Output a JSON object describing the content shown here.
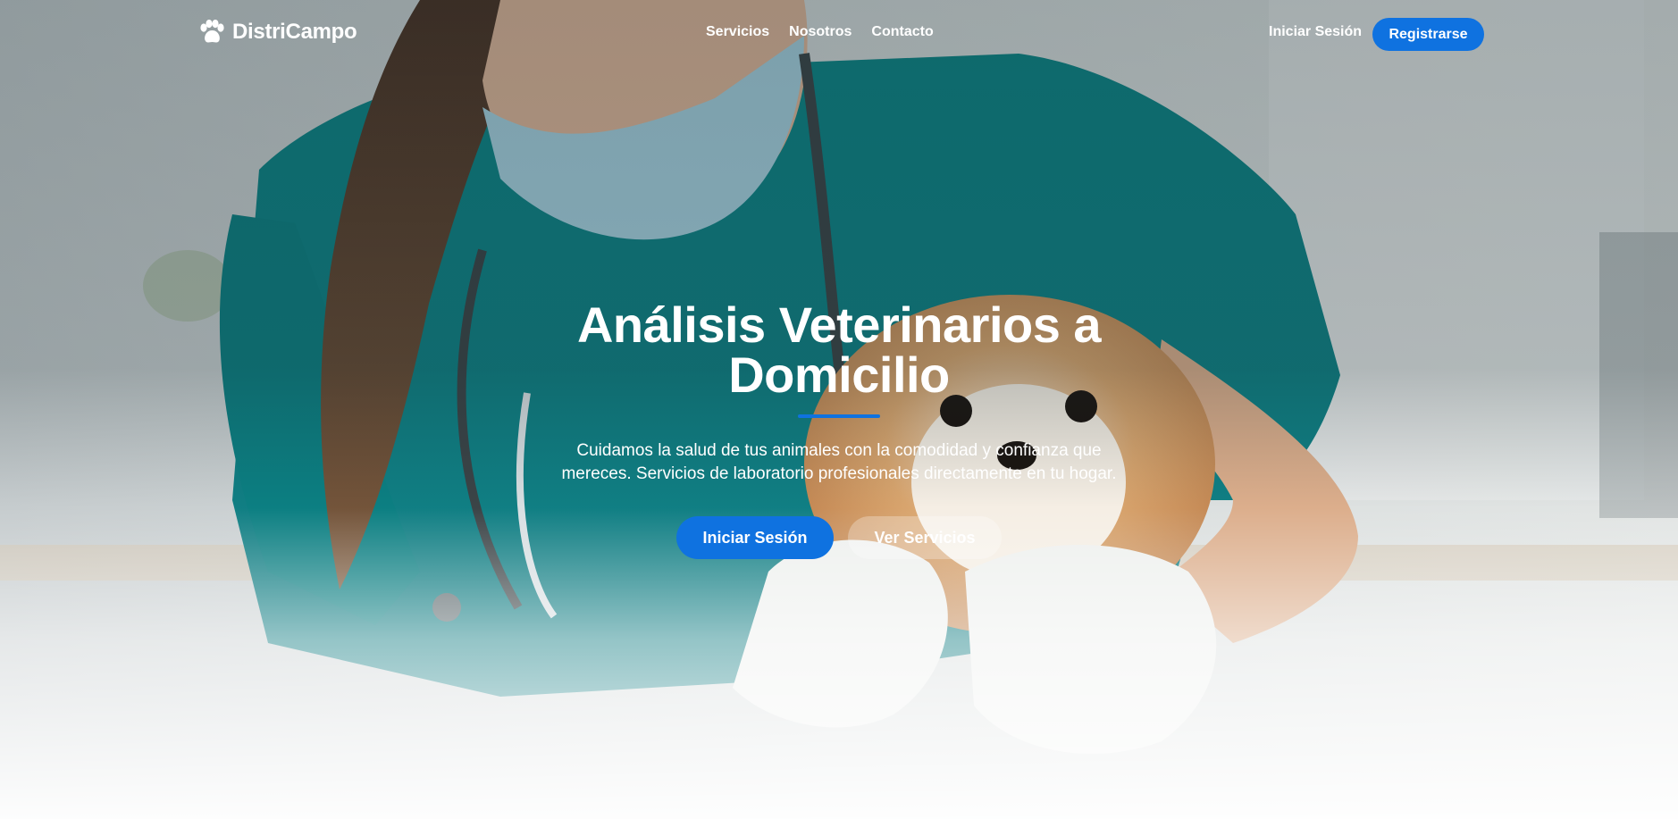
{
  "brand": {
    "name": "DistriCampo",
    "icon": "paw-icon"
  },
  "nav": {
    "links": [
      "Servicios",
      "Nosotros",
      "Contacto"
    ],
    "login_label": "Iniciar Sesión",
    "register_label": "Registrarse"
  },
  "hero": {
    "title": "Análisis Veterinarios a Domicilio",
    "subtitle": "Cuidamos la salud de tus animales con la comodidad y confianza que mereces. Servicios de laboratorio profesionales directamente en tu hogar.",
    "primary_cta": "Iniciar Sesión",
    "secondary_cta": "Ver Servicios"
  },
  "colors": {
    "accent": "#0f72e0",
    "scrubs": "#0e8a8c",
    "text": "#ffffff"
  }
}
